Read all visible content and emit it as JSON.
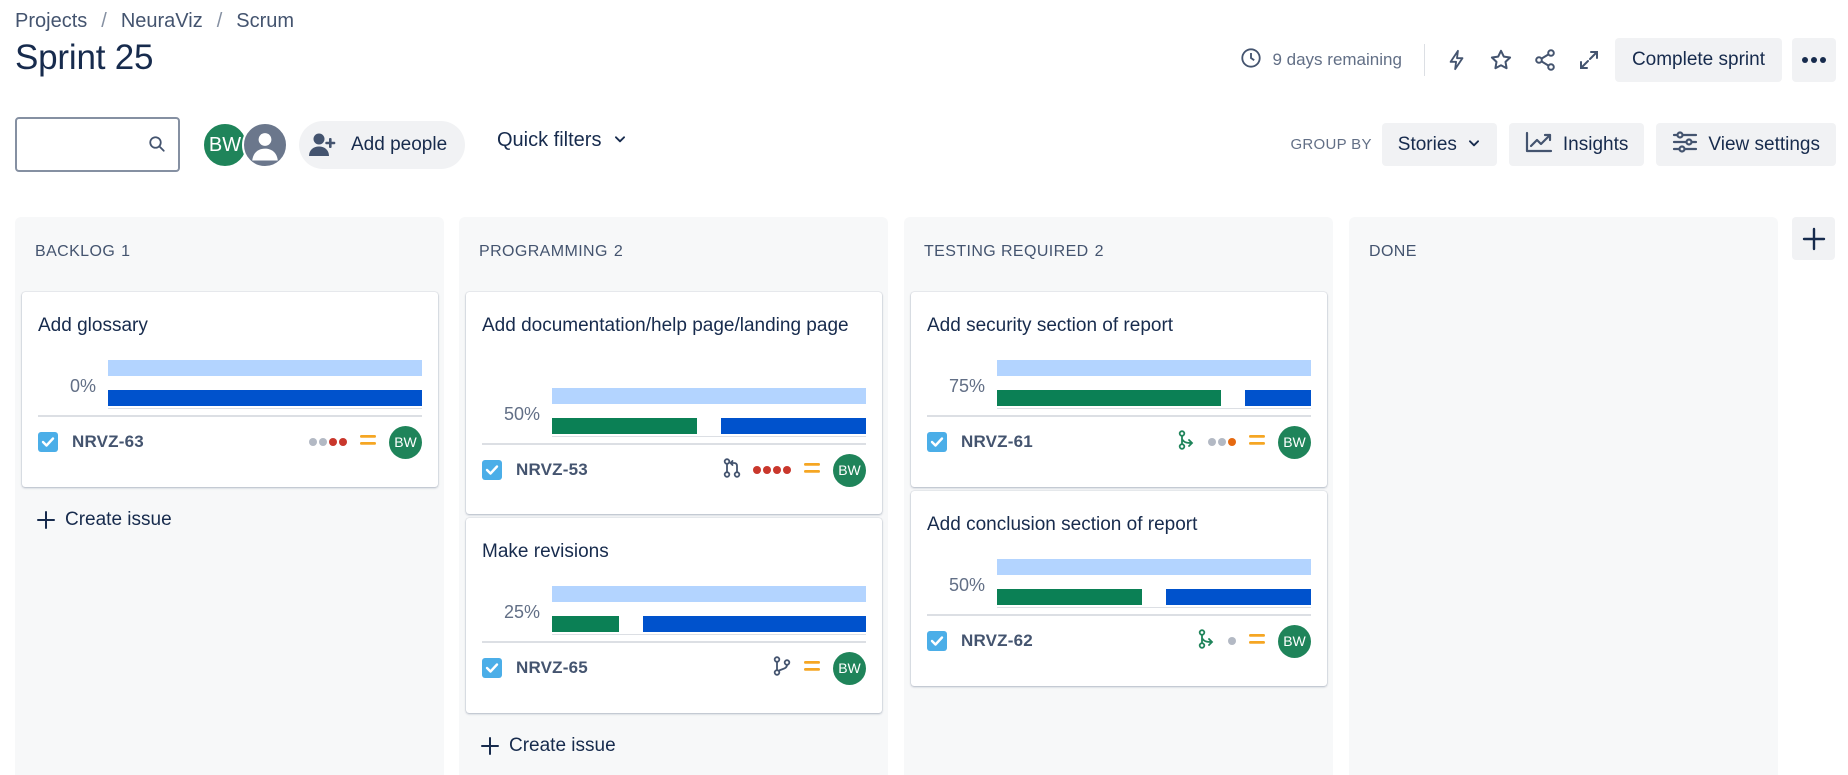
{
  "breadcrumb": {
    "items": [
      "Projects",
      "NeuraViz",
      "Scrum"
    ],
    "separator": "/"
  },
  "page_title": "Sprint 25",
  "header": {
    "time_remaining": "9 days remaining",
    "complete_sprint_label": "Complete sprint",
    "icons": [
      "clock-icon",
      "lightning-icon",
      "star-icon",
      "share-icon",
      "expand-icon",
      "more-icon"
    ]
  },
  "toolbar": {
    "search_placeholder": "",
    "avatars": [
      {
        "initials": "BW",
        "color": "#1f845a"
      },
      {
        "initials": "",
        "color": "#6b778c"
      }
    ],
    "add_people_label": "Add people",
    "quick_filters_label": "Quick filters",
    "group_by_label": "GROUP BY",
    "group_by_value": "Stories",
    "insights_label": "Insights",
    "view_settings_label": "View settings"
  },
  "colors": {
    "progress_todo": "#b3d4ff",
    "progress_done": "#0b8055",
    "progress_remaining": "#0052cc",
    "avatar": "#1f845a",
    "checkbox": "#4baee8",
    "priority_medium": "#f5a623"
  },
  "create_issue_label": "Create issue",
  "columns": [
    {
      "name": "BACKLOG",
      "count": "1",
      "cards": [
        {
          "title": "Add glossary",
          "progress_label": "0%",
          "done_fraction": 0.0,
          "key": "NRVZ-63",
          "branch_icon": "",
          "dots": [
            "#b3b9c4",
            "#b3b9c4",
            "#c9372c",
            "#c9372c"
          ],
          "assignee": "BW"
        }
      ]
    },
    {
      "name": "PROGRAMMING",
      "count": "2",
      "cards": [
        {
          "title": "Add documentation/help page/landing page",
          "progress_label": "50%",
          "done_fraction": 0.5,
          "key": "NRVZ-53",
          "branch_icon": "pull-request-icon",
          "dots": [
            "#c9372c",
            "#c9372c",
            "#c9372c",
            "#c9372c"
          ],
          "assignee": "BW"
        },
        {
          "title": "Make revisions",
          "progress_label": "25%",
          "done_fraction": 0.25,
          "key": "NRVZ-65",
          "branch_icon": "branch-icon",
          "dots": [],
          "assignee": "BW"
        }
      ]
    },
    {
      "name": "TESTING REQUIRED",
      "count": "2",
      "cards": [
        {
          "title": "Add security section of report",
          "progress_label": "75%",
          "done_fraction": 0.75,
          "key": "NRVZ-61",
          "branch_icon": "merged-icon",
          "dots": [
            "#b3b9c4",
            "#b3b9c4",
            "#e56910"
          ],
          "assignee": "BW"
        },
        {
          "title": "Add conclusion section of report",
          "progress_label": "50%",
          "done_fraction": 0.5,
          "key": "NRVZ-62",
          "branch_icon": "merged-icon",
          "dots": [
            "#b3b9c4"
          ],
          "assignee": "BW"
        }
      ]
    },
    {
      "name": "DONE",
      "count": "",
      "cards": []
    }
  ]
}
